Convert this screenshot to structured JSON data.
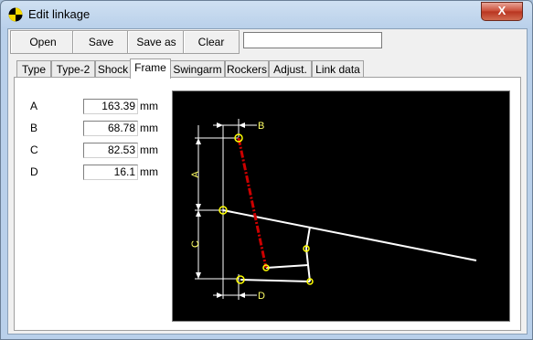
{
  "window": {
    "title": "Edit linkage",
    "close_label": "X"
  },
  "toolbar": {
    "open_label": "Open",
    "save_label": "Save",
    "save_as_label": "Save as",
    "clear_label": "Clear",
    "name_value": ""
  },
  "tabs": [
    {
      "label": "Type"
    },
    {
      "label": "Type-2"
    },
    {
      "label": "Shock"
    },
    {
      "label": "Frame",
      "active": true
    },
    {
      "label": "Swingarm"
    },
    {
      "label": "Rockers"
    },
    {
      "label": "Adjust."
    },
    {
      "label": "Link data"
    }
  ],
  "frame": {
    "params": [
      {
        "label": "A",
        "value": "163.39",
        "unit": "mm"
      },
      {
        "label": "B",
        "value": "68.78",
        "unit": "mm"
      },
      {
        "label": "C",
        "value": "82.53",
        "unit": "mm"
      },
      {
        "label": "D",
        "value": "16.1",
        "unit": "mm"
      }
    ],
    "diagram": {
      "dimension_labels": {
        "a": "A",
        "b": "B",
        "c": "C",
        "d": "D"
      },
      "colors": {
        "background": "#000000",
        "dimension": "#ffffff",
        "label": "#ffff66",
        "pivot": "#ffff00",
        "link": "#ffffff",
        "shock": "#cc0000"
      }
    }
  }
}
